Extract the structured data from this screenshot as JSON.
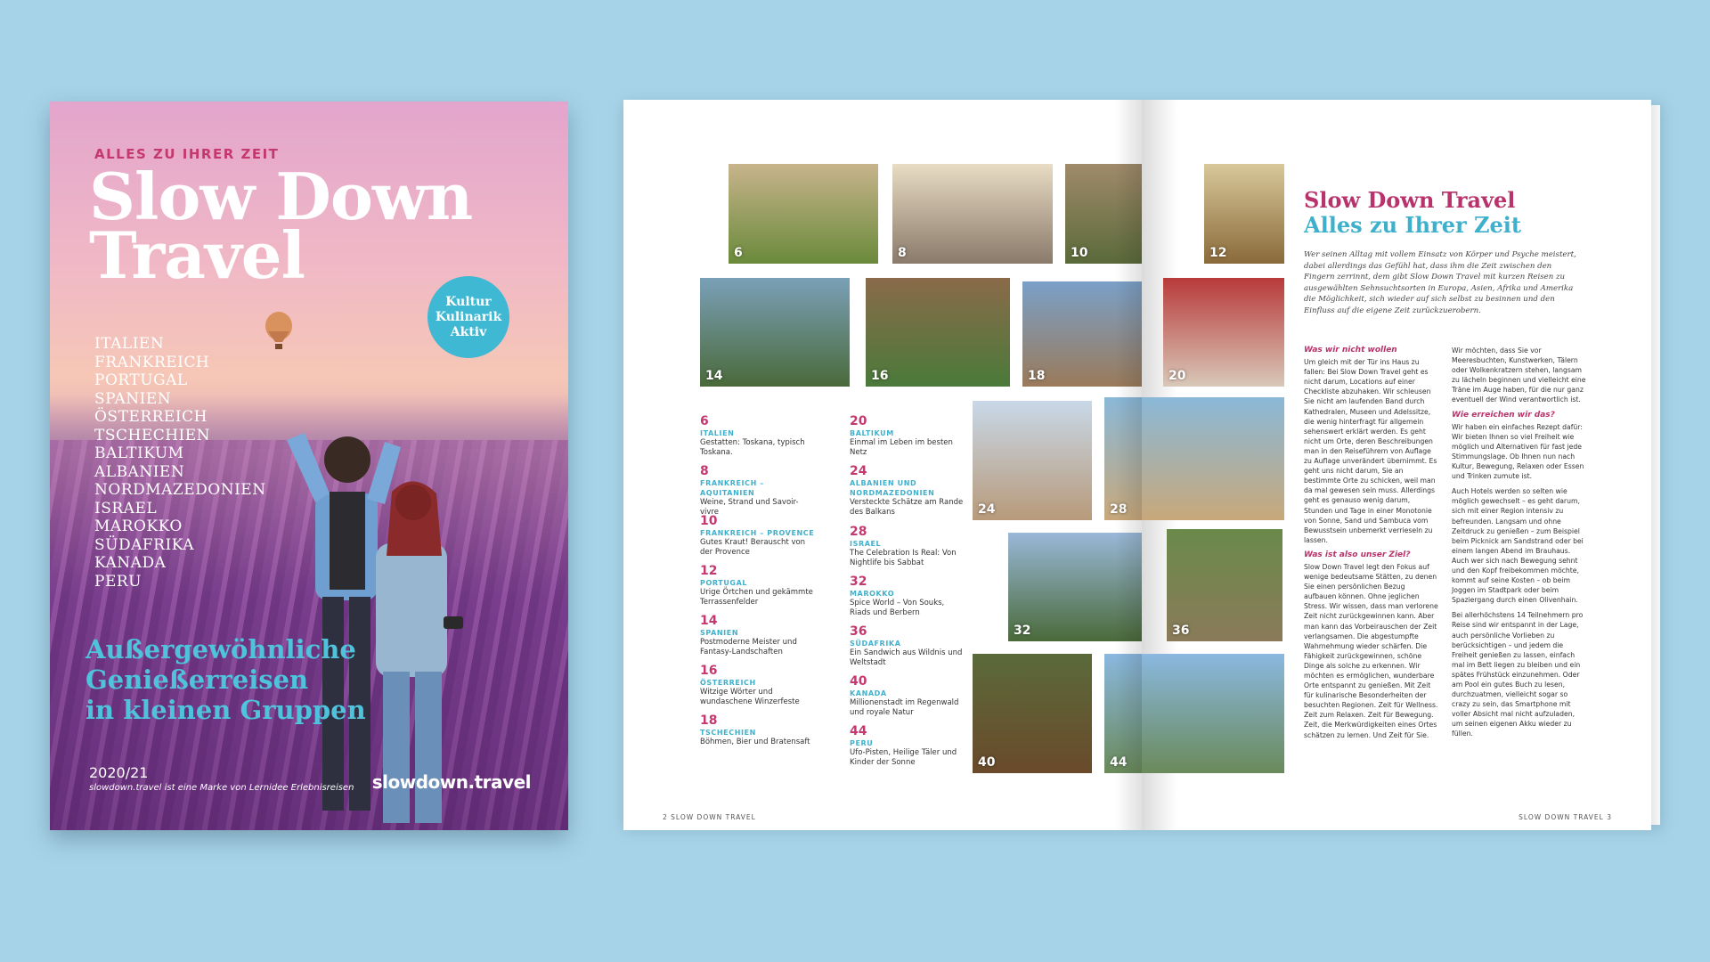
{
  "cover": {
    "kicker": "ALLES ZU IHRER ZEIT",
    "title_line1": "Slow Down",
    "title_line2": "Travel",
    "countries": [
      "ITALIEN",
      "FRANKREICH",
      "PORTUGAL",
      "SPANIEN",
      "ÖSTERREICH",
      "TSCHECHIEN",
      "BALTIKUM",
      "ALBANIEN",
      "NORDMAZEDONIEN",
      "ISRAEL",
      "MAROKKO",
      "SÜDAFRIKA",
      "KANADA",
      "PERU"
    ],
    "badge": [
      "Kultur",
      "Kulinarik",
      "Aktiv"
    ],
    "tagline": [
      "Außergewöhnliche",
      "Genießerreisen",
      "in kleinen Gruppen"
    ],
    "year": "2020/21",
    "brand_note": "slowdown.travel ist eine Marke von Lernidee Erlebnisreisen",
    "url": "slowdown.travel"
  },
  "left_page": {
    "photos": [
      {
        "num": "6",
        "colors": [
          "#c8b48c",
          "#6a8a3a"
        ]
      },
      {
        "num": "8",
        "colors": [
          "#e8dcc4",
          "#8a7a6a"
        ]
      },
      {
        "num": "10",
        "colors": [
          "#a08a6a",
          "#5a6a3a"
        ]
      },
      {
        "num": "12",
        "colors": [
          "#d8c89a",
          "#8a6a3a"
        ]
      },
      {
        "num": "14",
        "colors": [
          "#7aa0b8",
          "#4a6a3a"
        ]
      },
      {
        "num": "16",
        "colors": [
          "#8a6a4a",
          "#4a7a3a"
        ]
      },
      {
        "num": "18",
        "colors": [
          "#7aa0c8",
          "#9a7a5a"
        ]
      },
      {
        "num": "20",
        "colors": [
          "#b83a3a",
          "#d8c8b8"
        ]
      },
      {
        "num": "24",
        "colors": [
          "#c8d8e8",
          "#b89a7a"
        ]
      },
      {
        "num": "28",
        "colors": [
          "#8ab8d8",
          "#c8a87a"
        ]
      },
      {
        "num": "32",
        "colors": [
          "#9ab8d8",
          "#4a6a3a"
        ]
      },
      {
        "num": "36",
        "colors": [
          "#6a8a4a",
          "#8a7a5a"
        ]
      },
      {
        "num": "40",
        "colors": [
          "#5a6a3a",
          "#6a4a2a"
        ]
      },
      {
        "num": "44",
        "colors": [
          "#8ab8e0",
          "#6a8a5a"
        ]
      }
    ],
    "toc": [
      {
        "page": "6",
        "dest": "ITALIEN",
        "desc": "Gestatten: Toskana, typisch Toskana."
      },
      {
        "page": "8",
        "dest": "FRANKREICH – AQUITANIEN",
        "desc": "Weine, Strand und Savoir-vivre"
      },
      {
        "page": "10",
        "dest": "FRANKREICH – PROVENCE",
        "desc": "Gutes Kraut! Berauscht von der Provence"
      },
      {
        "page": "12",
        "dest": "PORTUGAL",
        "desc": "Urige Örtchen und gekämmte Terrassenfelder"
      },
      {
        "page": "14",
        "dest": "SPANIEN",
        "desc": "Postmoderne Meister und Fantasy-Landschaften"
      },
      {
        "page": "16",
        "dest": "ÖSTERREICH",
        "desc": "Witzige Wörter und wundaschene Winzerfeste"
      },
      {
        "page": "18",
        "dest": "TSCHECHIEN",
        "desc": "Böhmen, Bier und Bratensaft"
      },
      {
        "page": "20",
        "dest": "BALTIKUM",
        "desc": "Einmal im Leben im besten Netz"
      },
      {
        "page": "24",
        "dest": "ALBANIEN UND NORDMAZEDONIEN",
        "desc": "Versteckte Schätze am Rande des Balkans"
      },
      {
        "page": "28",
        "dest": "ISRAEL",
        "desc": "The Celebration Is Real: Von Nightlife bis Sabbat"
      },
      {
        "page": "32",
        "dest": "MAROKKO",
        "desc": "Spice World – Von Souks, Riads und Berbern"
      },
      {
        "page": "36",
        "dest": "SÜDAFRIKA",
        "desc": "Ein Sandwich aus Wildnis und Weltstadt"
      },
      {
        "page": "40",
        "dest": "KANADA",
        "desc": "Millionenstadt im Regenwald und royale Natur"
      },
      {
        "page": "44",
        "dest": "PERU",
        "desc": "Ufo-Pisten, Heilige Täler und Kinder der Sonne"
      }
    ],
    "folio_num": "2",
    "folio_text": "SLOW DOWN TRAVEL"
  },
  "right_page": {
    "heading1": "Slow Down Travel",
    "heading2": "Alles zu Ihrer Zeit",
    "lead": "Wer seinen Alltag mit vollem Einsatz von Körper und Psyche meistert, dabei allerdings das Gefühl hat, dass ihm die Zeit zwischen den Fingern zerrinnt, dem gibt Slow Down Travel mit kurzen Reisen zu ausgewählten Sehnsuchtsorten in Europa, Asien, Afrika und Amerika die Möglichkeit, sich wieder auf sich selbst zu besinnen und den Einfluss auf die eigene Zeit zurückzuerobern.",
    "col1": [
      {
        "heading": "Was wir nicht wollen",
        "text": "Um gleich mit der Tür ins Haus zu fallen: Bei Slow Down Travel geht es nicht darum, Locations auf einer Checkliste abzuhaken. Wir schleusen Sie nicht am laufenden Band durch Kathedralen, Museen und Adelssitze, die wenig hinterfragt für allgemein sehenswert erklärt werden. Es geht nicht um Orte, deren Beschreibungen man in den Reiseführern von Auflage zu Auflage unverändert übernimmt. Es geht uns nicht darum, Sie an bestimmte Orte zu schicken, weil man da mal gewesen sein muss. Allerdings geht es genauso wenig darum, Stunden und Tage in einer Monotonie von Sonne, Sand und Sambuca vom Bewusstsein unbemerkt verrieseln zu lassen."
      },
      {
        "heading": "Was ist also unser Ziel?",
        "text": "Slow Down Travel legt den Fokus auf wenige bedeutsame Stätten, zu denen Sie einen persönlichen Bezug aufbauen können. Ohne jeglichen Stress. Wir wissen, dass man verlorene Zeit nicht zurückgewinnen kann. Aber man kann das Vorbeirauschen der Zeit verlangsamen. Die abgestumpfte Wahrnehmung wieder schärfen. Die Fähigkeit zurückgewinnen, schöne Dinge als solche zu erkennen. Wir möchten es ermöglichen, wunderbare Orte entspannt zu genießen. Mit Zeit für kulinarische Besonderheiten der besuchten Regionen. Zeit für Wellness. Zeit zum Relaxen. Zeit für Bewegung. Zeit, die Merkwürdigkeiten eines Ortes schätzen zu lernen. Und Zeit für Sie."
      }
    ],
    "col2": [
      {
        "heading": "",
        "text": "Wir möchten, dass Sie vor Meeresbuchten, Kunstwerken, Tälern oder Wolkenkratzern stehen, langsam zu lächeln beginnen und vielleicht eine Träne im Auge haben, für die nur ganz eventuell der Wind verantwortlich ist."
      },
      {
        "heading": "Wie erreichen wir das?",
        "text": "Wir haben ein einfaches Rezept dafür: Wir bieten Ihnen so viel Freiheit wie möglich und Alternativen für fast jede Stimmungslage. Ob Ihnen nun nach Kultur, Bewegung, Relaxen oder Essen und Trinken zumute ist."
      },
      {
        "heading": "",
        "text": "Auch Hotels werden so selten wie möglich gewechselt – es geht darum, sich mit einer Region intensiv zu befreunden. Langsam und ohne Zeitdruck zu genießen – zum Beispiel beim Picknick am Sandstrand oder bei einem langen Abend im Brauhaus. Auch wer sich nach Bewegung sehnt und den Kopf freibekommen möchte, kommt auf seine Kosten – ob beim Joggen im Stadtpark oder beim Spaziergang durch einen Olivenhain."
      },
      {
        "heading": "",
        "text": "Bei allerhöchstens 14 Teilnehmern pro Reise sind wir entspannt in der Lage, auch persönliche Vorlieben zu berücksichtigen – und jedem die Freiheit genießen zu lassen, einfach mal im Bett liegen zu bleiben und ein spätes Frühstück einzunehmen. Oder am Pool ein gutes Buch zu lesen, durchzuatmen, vielleicht sogar so crazy zu sein, das Smartphone mit voller Absicht mal nicht aufzuladen, um seinen eigenen Akku wieder zu füllen."
      }
    ],
    "folio_text": "SLOW DOWN TRAVEL",
    "folio_num": "3"
  }
}
